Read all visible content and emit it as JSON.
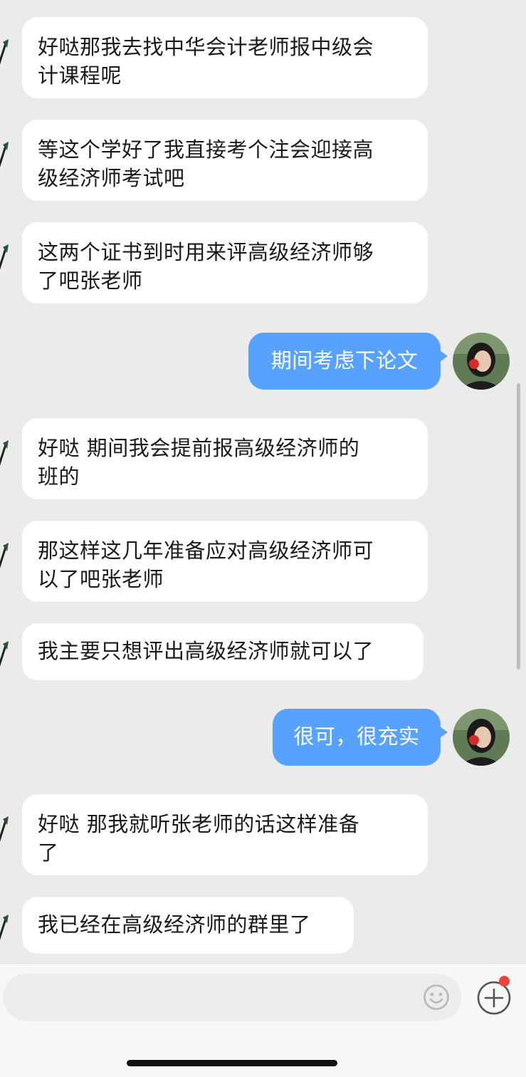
{
  "chat": {
    "messages": [
      {
        "side": "in",
        "lines": [
          "好哒那我去找中华会计老师报中级会",
          "计课程呢"
        ]
      },
      {
        "side": "in",
        "lines": [
          "等这个学好了我直接考个注会迎接高",
          "级经济师考试吧"
        ]
      },
      {
        "side": "in",
        "lines": [
          "这两个证书到时用来评高级经济师够",
          "了吧张老师"
        ]
      },
      {
        "side": "out",
        "lines": [
          "期间考虑下论文"
        ]
      },
      {
        "side": "in",
        "lines": [
          "好哒 期间我会提前报高级经济师的",
          "班的"
        ]
      },
      {
        "side": "in",
        "lines": [
          "那这样这几年准备应对高级经济师可",
          "以了吧张老师"
        ]
      },
      {
        "side": "in",
        "lines": [
          "我主要只想评出高级经济师就可以了"
        ]
      },
      {
        "side": "out",
        "lines": [
          "很可，很充实"
        ]
      },
      {
        "side": "in",
        "lines": [
          "好哒 那我就听张老师的话这样准备",
          "了"
        ]
      },
      {
        "side": "in",
        "lines": [
          "我已经在高级经济师的群里了"
        ]
      }
    ]
  },
  "colors": {
    "background": "#ebebeb",
    "incoming_bubble": "#ffffff",
    "outgoing_bubble": "#57a2ff",
    "notification_dot": "#f04238"
  },
  "input_bar": {
    "icons": {
      "emoji": "smiley-face-icon",
      "more": "plus-circle-icon"
    },
    "has_notification": true
  }
}
